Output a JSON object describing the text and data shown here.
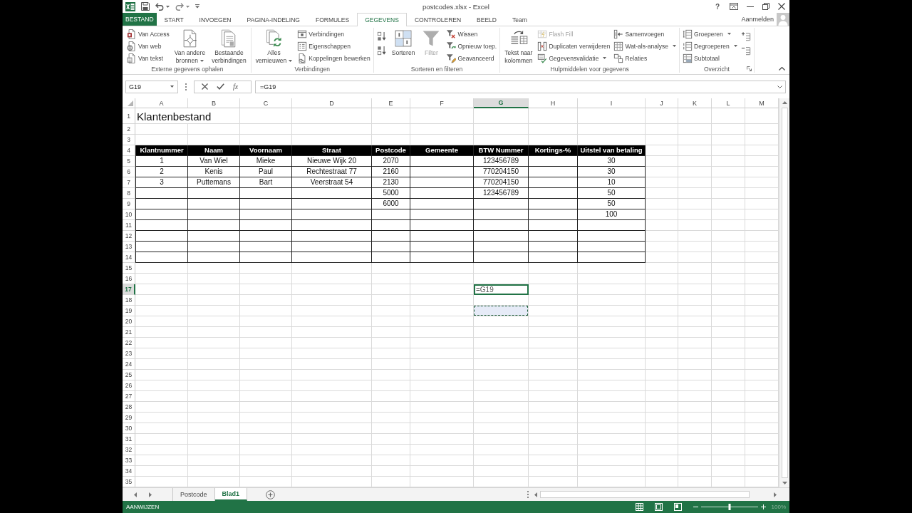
{
  "window": {
    "title": "postcodes.xlsx - Excel",
    "help": "?"
  },
  "ribbon_tabs": [
    {
      "label": "BESTAND",
      "kind": "file",
      "selected": false
    },
    {
      "label": "START",
      "kind": "tab",
      "selected": false
    },
    {
      "label": "INVOEGEN",
      "kind": "tab",
      "selected": false
    },
    {
      "label": "PAGINA-INDELING",
      "kind": "tab",
      "selected": false
    },
    {
      "label": "FORMULES",
      "kind": "tab",
      "selected": false
    },
    {
      "label": "GEGEVENS",
      "kind": "tab",
      "selected": true
    },
    {
      "label": "CONTROLEREN",
      "kind": "tab",
      "selected": false
    },
    {
      "label": "BEELD",
      "kind": "tab",
      "selected": false
    },
    {
      "label": "Team",
      "kind": "tab",
      "selected": false
    }
  ],
  "account": {
    "label": "Aanmelden"
  },
  "ribbon": {
    "groups": [
      {
        "label": "Externe gegevens ophalen",
        "launcher": false,
        "columns": [
          {
            "kind": "stack",
            "items": [
              {
                "label": "Van Access",
                "menu": false,
                "disabled": false
              },
              {
                "label": "Van web",
                "menu": false,
                "disabled": false
              },
              {
                "label": "Van tekst",
                "menu": false,
                "disabled": false
              }
            ]
          },
          {
            "kind": "large",
            "items": [
              {
                "label": "Van andere\nbronnen",
                "menu": true,
                "disabled": false
              }
            ]
          },
          {
            "kind": "large",
            "items": [
              {
                "label": "Bestaande\nverbindingen",
                "menu": false,
                "disabled": false
              }
            ]
          }
        ]
      },
      {
        "label": "Verbindingen",
        "launcher": false,
        "columns": [
          {
            "kind": "large",
            "items": [
              {
                "label": "Alles\nvernieuwen",
                "menu": true,
                "disabled": false
              }
            ]
          },
          {
            "kind": "stack",
            "items": [
              {
                "label": "Verbindingen",
                "menu": false,
                "disabled": false
              },
              {
                "label": "Eigenschappen",
                "menu": false,
                "disabled": false
              },
              {
                "label": "Koppelingen bewerken",
                "menu": false,
                "disabled": false
              }
            ]
          }
        ]
      },
      {
        "label": "Sorteren en filteren",
        "launcher": false,
        "columns": [
          {
            "kind": "icons",
            "items": [
              {
                "menu": false,
                "disabled": false
              },
              {
                "menu": false,
                "disabled": false
              }
            ]
          },
          {
            "kind": "large",
            "items": [
              {
                "label": "Sorteren",
                "menu": false,
                "disabled": false
              }
            ]
          },
          {
            "kind": "large",
            "items": [
              {
                "label": "Filter",
                "menu": false,
                "disabled": true
              }
            ]
          },
          {
            "kind": "stack",
            "items": [
              {
                "label": "Wissen",
                "menu": false,
                "disabled": false
              },
              {
                "label": "Opnieuw toep.",
                "menu": false,
                "disabled": false
              },
              {
                "label": "Geavanceerd",
                "menu": false,
                "disabled": false
              }
            ]
          }
        ]
      },
      {
        "label": "Hulpmiddelen voor gegevens",
        "launcher": false,
        "columns": [
          {
            "kind": "large",
            "items": [
              {
                "label": "Tekst naar\nkolommen",
                "menu": false,
                "disabled": false
              }
            ]
          },
          {
            "kind": "stack",
            "items": [
              {
                "label": "Flash Fill",
                "menu": false,
                "disabled": true
              },
              {
                "label": "Duplicaten verwijderen",
                "menu": false,
                "disabled": false
              },
              {
                "label": "Gegevensvalidatie",
                "menu": true,
                "disabled": false
              }
            ]
          },
          {
            "kind": "stack",
            "items": [
              {
                "label": "Samenvoegen",
                "menu": false,
                "disabled": false
              },
              {
                "label": "Wat-als-analyse",
                "menu": true,
                "disabled": false
              },
              {
                "label": "Relaties",
                "menu": false,
                "disabled": false
              }
            ]
          }
        ]
      },
      {
        "label": "Overzicht",
        "launcher": true,
        "columns": [
          {
            "kind": "stack",
            "items": [
              {
                "label": "Groeperen",
                "menu": true,
                "disabled": false
              },
              {
                "label": "Degroeperen",
                "menu": true,
                "disabled": false
              },
              {
                "label": "Subtotaal",
                "menu": false,
                "disabled": false
              }
            ]
          },
          {
            "kind": "icons",
            "items": [
              {
                "menu": false,
                "disabled": false
              },
              {
                "menu": false,
                "disabled": false
              }
            ]
          }
        ]
      }
    ]
  },
  "formula_bar": {
    "name_box": "G19",
    "function_label": "fx",
    "formula": "=G19"
  },
  "grid": {
    "columns": [
      {
        "label": "A",
        "selected": false
      },
      {
        "label": "B",
        "selected": false
      },
      {
        "label": "C",
        "selected": false
      },
      {
        "label": "D",
        "selected": false
      },
      {
        "label": "E",
        "selected": false
      },
      {
        "label": "F",
        "selected": false
      },
      {
        "label": "G",
        "selected": true
      },
      {
        "label": "H",
        "selected": false
      },
      {
        "label": "I",
        "selected": false
      },
      {
        "label": "J",
        "selected": false
      },
      {
        "label": "K",
        "selected": false
      },
      {
        "label": "L",
        "selected": false
      },
      {
        "label": "M",
        "selected": false
      }
    ],
    "rows": [
      {
        "label": "1",
        "kind": "title",
        "selected": false,
        "cells": [
          {
            "kind": "value",
            "text": "Klantenbestand"
          }
        ]
      },
      {
        "label": "2",
        "kind": "plain",
        "selected": false
      },
      {
        "label": "3",
        "kind": "plain",
        "selected": false
      },
      {
        "label": "4",
        "kind": "header",
        "selected": false,
        "cells": [
          {
            "kind": "value",
            "text": "Klantnummer"
          },
          {
            "kind": "value",
            "text": "Naam"
          },
          {
            "kind": "value",
            "text": "Voornaam"
          },
          {
            "kind": "value",
            "text": "Straat"
          },
          {
            "kind": "value",
            "text": "Postcode"
          },
          {
            "kind": "value",
            "text": "Gemeente"
          },
          {
            "kind": "value",
            "text": "BTW Nummer"
          },
          {
            "kind": "value",
            "text": "Kortings-%"
          },
          {
            "kind": "value",
            "text": "Uitstel van betaling"
          }
        ]
      },
      {
        "label": "5",
        "kind": "record",
        "selected": false,
        "cells": [
          {
            "kind": "value",
            "text": "1"
          },
          {
            "kind": "value",
            "text": "Van Wiel"
          },
          {
            "kind": "value",
            "text": "Mieke"
          },
          {
            "kind": "value",
            "text": "Nieuwe Wijk 20"
          },
          {
            "kind": "value",
            "text": "2070"
          },
          null,
          {
            "kind": "value",
            "text": "123456789"
          },
          null,
          {
            "kind": "value",
            "text": "30"
          }
        ]
      },
      {
        "label": "6",
        "kind": "record",
        "selected": false,
        "cells": [
          {
            "kind": "value",
            "text": "2"
          },
          {
            "kind": "value",
            "text": "Kenis"
          },
          {
            "kind": "value",
            "text": "Paul"
          },
          {
            "kind": "value",
            "text": "Rechtestraat 77"
          },
          {
            "kind": "value",
            "text": "2160"
          },
          null,
          {
            "kind": "value",
            "text": "770204150"
          },
          null,
          {
            "kind": "value",
            "text": "30"
          }
        ]
      },
      {
        "label": "7",
        "kind": "record",
        "selected": false,
        "cells": [
          {
            "kind": "value",
            "text": "3"
          },
          {
            "kind": "value",
            "text": "Puttemans"
          },
          {
            "kind": "value",
            "text": "Bart"
          },
          {
            "kind": "value",
            "text": "Veerstraat 54"
          },
          {
            "kind": "value",
            "text": "2130"
          },
          null,
          {
            "kind": "value",
            "text": "770204150"
          },
          null,
          {
            "kind": "value",
            "text": "10"
          }
        ]
      },
      {
        "label": "8",
        "kind": "record",
        "selected": false,
        "cells": [
          null,
          null,
          null,
          null,
          {
            "kind": "value",
            "text": "5000"
          },
          null,
          {
            "kind": "value",
            "text": "123456789"
          },
          null,
          {
            "kind": "value",
            "text": "50"
          }
        ]
      },
      {
        "label": "9",
        "kind": "record",
        "selected": false,
        "cells": [
          null,
          null,
          null,
          null,
          {
            "kind": "value",
            "text": "6000"
          },
          null,
          null,
          null,
          {
            "kind": "value",
            "text": "50"
          }
        ]
      },
      {
        "label": "10",
        "kind": "record",
        "selected": false,
        "cells": [
          null,
          null,
          null,
          null,
          null,
          null,
          null,
          null,
          {
            "kind": "value",
            "text": "100"
          }
        ]
      },
      {
        "label": "11",
        "kind": "record",
        "selected": false
      },
      {
        "label": "12",
        "kind": "record",
        "selected": false
      },
      {
        "label": "13",
        "kind": "record",
        "selected": false
      },
      {
        "label": "14",
        "kind": "record",
        "selected": false
      },
      {
        "label": "15",
        "kind": "plain",
        "selected": false
      },
      {
        "label": "16",
        "kind": "plain",
        "selected": false
      },
      {
        "label": "17",
        "kind": "plain",
        "selected": true,
        "cells": [
          null,
          null,
          null,
          null,
          null,
          null,
          {
            "kind": "editing",
            "text": "=G19"
          }
        ]
      },
      {
        "label": "18",
        "kind": "plain",
        "selected": false
      },
      {
        "label": "19",
        "kind": "plain",
        "selected": false,
        "cells": [
          null,
          null,
          null,
          null,
          null,
          null,
          {
            "kind": "marquee"
          }
        ]
      },
      {
        "label": "20",
        "kind": "plain",
        "selected": false
      },
      {
        "label": "21",
        "kind": "plain",
        "selected": false
      },
      {
        "label": "22",
        "kind": "plain",
        "selected": false
      },
      {
        "label": "23",
        "kind": "plain",
        "selected": false
      },
      {
        "label": "24",
        "kind": "plain",
        "selected": false
      },
      {
        "label": "25",
        "kind": "plain",
        "selected": false
      },
      {
        "label": "26",
        "kind": "plain",
        "selected": false
      },
      {
        "label": "27",
        "kind": "plain",
        "selected": false
      },
      {
        "label": "28",
        "kind": "plain",
        "selected": false
      },
      {
        "label": "29",
        "kind": "plain",
        "selected": false
      },
      {
        "label": "30",
        "kind": "plain",
        "selected": false
      },
      {
        "label": "31",
        "kind": "plain",
        "selected": false
      },
      {
        "label": "32",
        "kind": "plain",
        "selected": false
      },
      {
        "label": "33",
        "kind": "plain",
        "selected": false
      },
      {
        "label": "34",
        "kind": "plain",
        "selected": false
      },
      {
        "label": "35",
        "kind": "plain",
        "selected": false
      }
    ]
  },
  "sheet_tabs": [
    {
      "label": "Postcode",
      "selected": false
    },
    {
      "label": "Blad1",
      "selected": true
    }
  ],
  "status_bar": {
    "mode": "AANWIJZEN",
    "zoom": {
      "level": 0.5,
      "reading": "100%"
    }
  }
}
